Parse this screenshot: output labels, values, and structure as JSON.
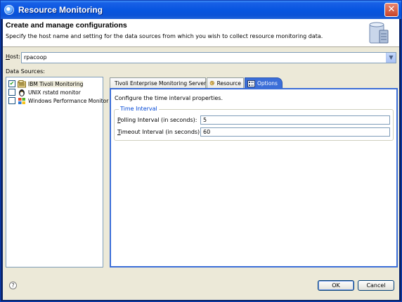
{
  "window": {
    "title": "Resource Monitoring",
    "close_glyph": "✕"
  },
  "header": {
    "title": "Create and manage configurations",
    "description": "Specify the host name and setting for the data sources from which you wish to collect resource monitoring data."
  },
  "host": {
    "label_mnemonic": "H",
    "label_rest": "ost:",
    "value": "rpacoop"
  },
  "data_sources": {
    "label": "Data Sources:",
    "items": [
      {
        "label": "IBM Tivoli Monitoring",
        "checked": true,
        "icon": "tivoli-icon"
      },
      {
        "label": "UNIX rstatd monitor",
        "checked": false,
        "icon": "unix-icon"
      },
      {
        "label": "Windows Performance Monitor",
        "checked": false,
        "icon": "windows-icon"
      }
    ]
  },
  "tabs": [
    {
      "label": "Tivoli Enterprise Monitoring Server",
      "icon": "monitor-icon",
      "active": false
    },
    {
      "label": "Resource",
      "icon": "resource-icon",
      "active": false
    },
    {
      "label": "Options",
      "icon": "options-icon",
      "active": true
    }
  ],
  "options": {
    "description": "Configure the time interval properties.",
    "group_title": "Time Interval",
    "polling_label_mnemonic": "P",
    "polling_label_rest": "olling Interval (in seconds):",
    "polling_value": "5",
    "timeout_label_mnemonic": "T",
    "timeout_label_rest": "imeout Interval (in seconds):",
    "timeout_value": "60"
  },
  "footer": {
    "help_glyph": "?",
    "ok_label": "OK",
    "cancel_label": "Cancel"
  },
  "colors": {
    "title_bar": "#0856e0",
    "active_tab": "#3b6ed8",
    "group_title": "#0046d5"
  }
}
